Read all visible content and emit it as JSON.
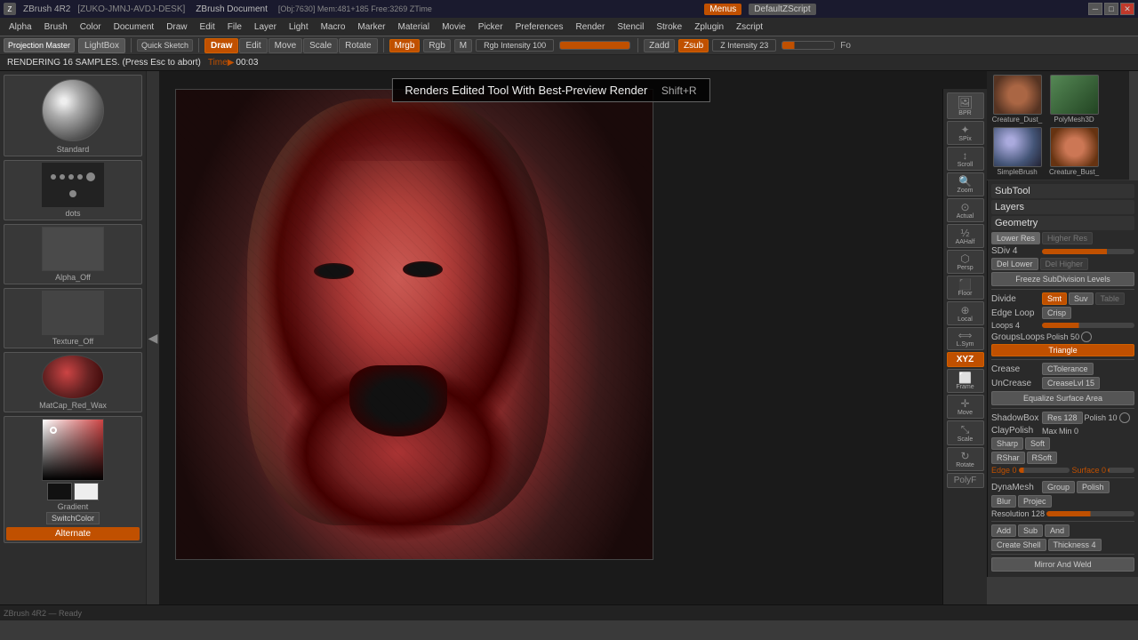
{
  "titlebar": {
    "title": "ZBrush Document",
    "app": "ZBrush 4R2",
    "machine": "[ZUKO-JMNJ-AVDJ-DESK]",
    "obj_info": "[Obj:7630] Mem:481+185 Free:3269 ZTime",
    "menus_label": "Menus",
    "default_script": "DefaultZScript",
    "minimize": "─",
    "maximize": "□",
    "close": "✕"
  },
  "menubar": {
    "items": [
      "Alpha",
      "Brush",
      "Color",
      "Document",
      "Draw",
      "Edit",
      "File",
      "Layer",
      "Light",
      "Macro",
      "Marker",
      "Material",
      "Movie",
      "Picker",
      "Preferences",
      "Render",
      "Stencil",
      "Stroke"
    ]
  },
  "toolbar": {
    "projection_master": "Projection Master",
    "light_box": "LightBox",
    "quick_sketch": "Quick Sketch",
    "draw": "Draw",
    "edit": "Edit",
    "move": "Move",
    "scale": "Scale",
    "rotate": "Rotate",
    "mrgb": "Mrgb",
    "rgb": "Rgb",
    "m": "M",
    "rgb_intensity": "Rgb Intensity 100",
    "zadd": "Zadd",
    "zsub": "Zsub",
    "z_intensity": "Z Intensity 23",
    "focal": "Fo"
  },
  "statusbar": {
    "text": "RENDERING 16 SAMPLES. (Press Esc to abort)",
    "time_label": "Time▶",
    "time": "00:03"
  },
  "render_tooltip": {
    "text": "Renders Edited Tool With Best-Preview Render",
    "shortcut": "Shift+R"
  },
  "left_sidebar": {
    "standard_label": "Standard",
    "dots_label": "dots",
    "alpha_off_label": "Alpha_Off",
    "texture_off_label": "Texture_Off",
    "matcap_label": "MatCap_Red_Wax",
    "gradient_label": "Gradient",
    "switch_color": "SwitchColor",
    "alternate": "Alternate"
  },
  "nav_icons": {
    "bpr": "BPR",
    "spix": "SPix",
    "scroll": "Scroll",
    "zoom": "Zoom",
    "actual": "Actual",
    "aahalf": "AAHalf",
    "persp": "Persp",
    "floor": "Floor",
    "local": "Local",
    "lsym": "L.Sym",
    "xyz": "XYZ",
    "frame": "Frame",
    "move": "Move",
    "scale": "Scale",
    "rotate": "Rotate",
    "polyf": "PolyF"
  },
  "thumbnails": {
    "creature_dust1": "Creature_Dust_",
    "polymesh3d": "PolyMesh3D",
    "simple_brush": "SimpleBrush",
    "creature_dust2": "Creature_Bust_"
  },
  "right_panel": {
    "subtool": "SubTool",
    "layers": "Layers",
    "geometry": "Geometry",
    "lower_res": "Lower Res",
    "higher_res": "Higher Res",
    "sdiv_label": "SDiv 4",
    "del_lower": "Del Lower",
    "del_higher": "Del Higher",
    "freeze": "Freeze SubDivision Levels",
    "divide": "Divide",
    "smt": "Smt",
    "suv": "Suv",
    "table": "Table",
    "edge_loop": "Edge Loop",
    "crisp": "Crisp",
    "loops_label": "Loops 4",
    "groups_loops": "GroupsLoops",
    "polish_50": "Polish 50",
    "triangle": "Triangle",
    "crease": "Crease",
    "ctolerance": "CTolerance",
    "uncrease": "UnCrease",
    "creaselvl15": "CreaseLvl 15",
    "equalize": "Equalize Surface Area",
    "shadowbox": "ShadowBox",
    "res128": "Res 128",
    "polish10": "Polish 10",
    "claypolish": "ClayPolish",
    "max": "Max",
    "min0": "Min 0",
    "sharp": "Sharp",
    "soft": "Soft",
    "rshar": "RShar",
    "rsoft": "RSoft",
    "edge0": "Edge 0",
    "surface0": "Surface 0",
    "dynamesh": "DynaMesh",
    "group": "Group",
    "polish": "Polish",
    "blur": "Blur",
    "project": "Projec",
    "resolution128": "Resolution 128",
    "add": "Add",
    "sub": "Sub",
    "and": "And",
    "create_shell": "Create Shell",
    "thickness4": "Thickness 4",
    "mirror_weld": "Mirror And Weld"
  }
}
